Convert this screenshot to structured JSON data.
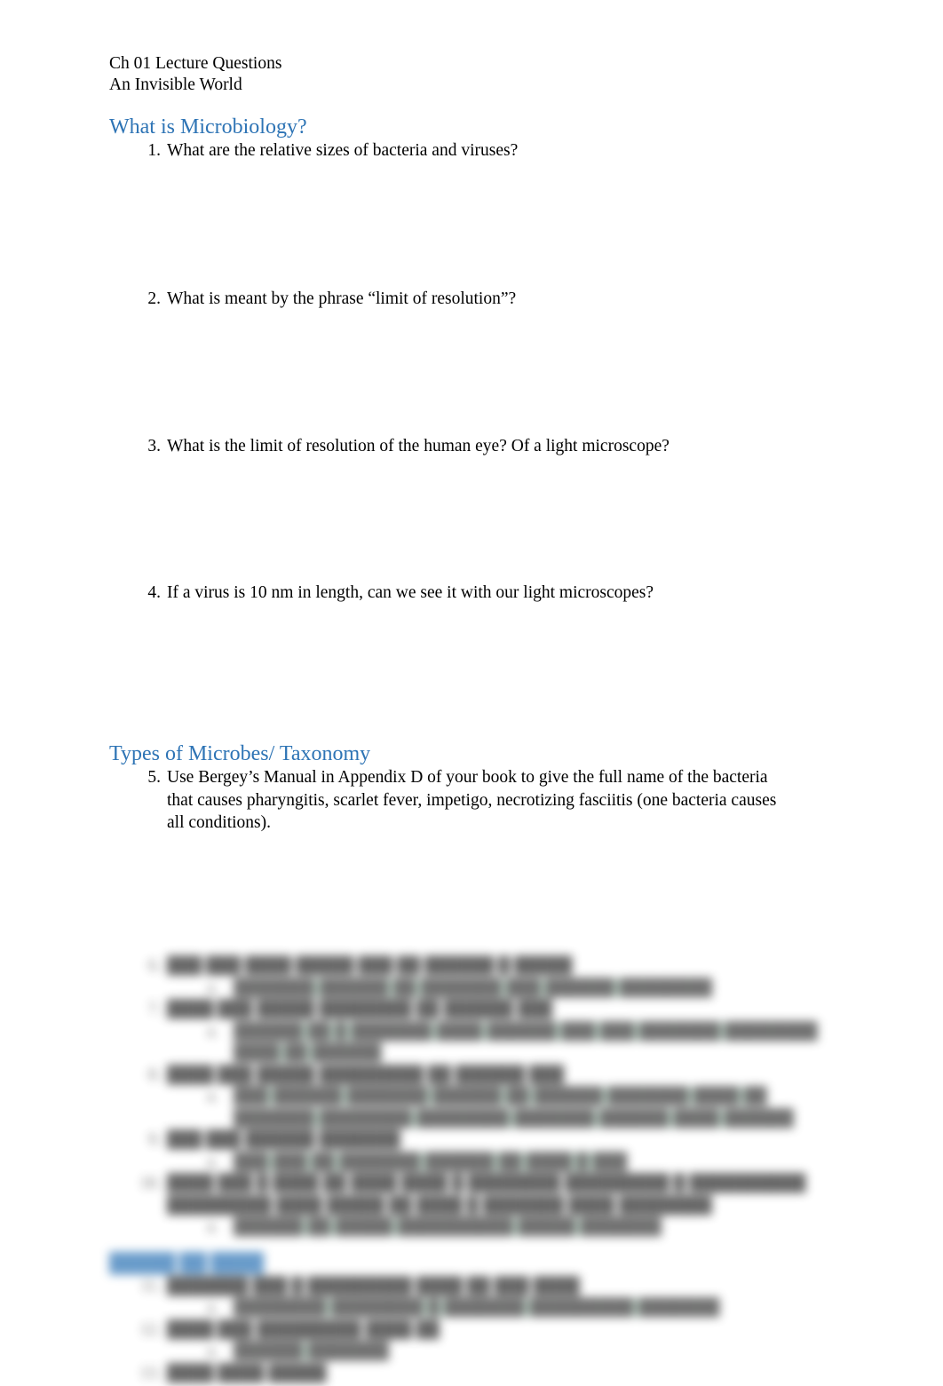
{
  "document": {
    "title_lines": [
      "Ch 01 Lecture Questions",
      "An Invisible World"
    ],
    "heading_color": "#2E74B5",
    "highlight_green": "#BFE9D2",
    "highlight_blue": "#D7E6F4"
  },
  "sections": [
    {
      "heading": "What is Microbiology?",
      "questions": [
        {
          "number": "1.",
          "text": "What are the relative sizes of bacteria and viruses?"
        },
        {
          "number": "2.",
          "text": "What is meant by the phrase “limit of resolution”?"
        },
        {
          "number": "3.",
          "text": "What is the limit of resolution of the human eye? Of a light microscope?"
        },
        {
          "number": "4.",
          "text": "If a virus is 10 nm in length, can we see it with our light microscopes?"
        }
      ]
    },
    {
      "heading": "Types of Microbes/ Taxonomy",
      "questions": [
        {
          "number": "5.",
          "text": "Use Bergey’s Manual in Appendix D of your book to give the full name of the bacteria that causes pharyngitis, scarlet fever, impetigo, necrotizing fasciitis (one bacteria causes all conditions)."
        }
      ]
    }
  ],
  "blurred_preview": {
    "note": "obscured",
    "items": [
      {
        "number": "6.",
        "text": "███ ███ ████ █████ ███ ██ ██████ █ █████",
        "answers": [
          "███████ ██████ ██ ███████ ███ ██████ ████████"
        ]
      },
      {
        "number": "7.",
        "text": "████ ███ █████ ████████ ██ ██████ ███",
        "answers": [
          "██████ ██ █ ███████ ████ ██████ ███ ███ ███████ ████████ ████ ██ ██████"
        ]
      },
      {
        "number": "8.",
        "text": "████ ███ █████ █████████ ██ ██████ ███",
        "answers": [
          "███ ██████ ███████ ██████ ██ ██████ ███████ ████ ██ ███████ ████████ ████████ ███████ ██████ ████ ██████"
        ]
      },
      {
        "number": "9.",
        "text": "███ ███ ██████ ███████",
        "answers": [
          "███ ███ ██ ███████ ██████ ██ ████ █ ███"
        ]
      },
      {
        "number": "10.",
        "text": "████ ███ █ ████ ██ ████ ████ █ ████████ █████████ █ ██████████ █████████ ████ █████ ██ ████ █ ███████ ████ ████████",
        "answers": [
          "██████ ██ █████ ██████████ █████ ███████"
        ]
      }
    ],
    "heading": "█████ ██ ████",
    "items2": [
      {
        "number": "11.",
        "text": "███████ ███ █ █████████ ████ ██ ███ ████",
        "answers": [
          "████████ ████████ █ ███████ █████████ ███████"
        ]
      },
      {
        "number": "12.",
        "text": "████ ███ █████████ ████ ██",
        "answers": [
          "██████ ███████"
        ]
      },
      {
        "number": "13.",
        "text": "████ ████ █████",
        "answers": []
      }
    ]
  }
}
